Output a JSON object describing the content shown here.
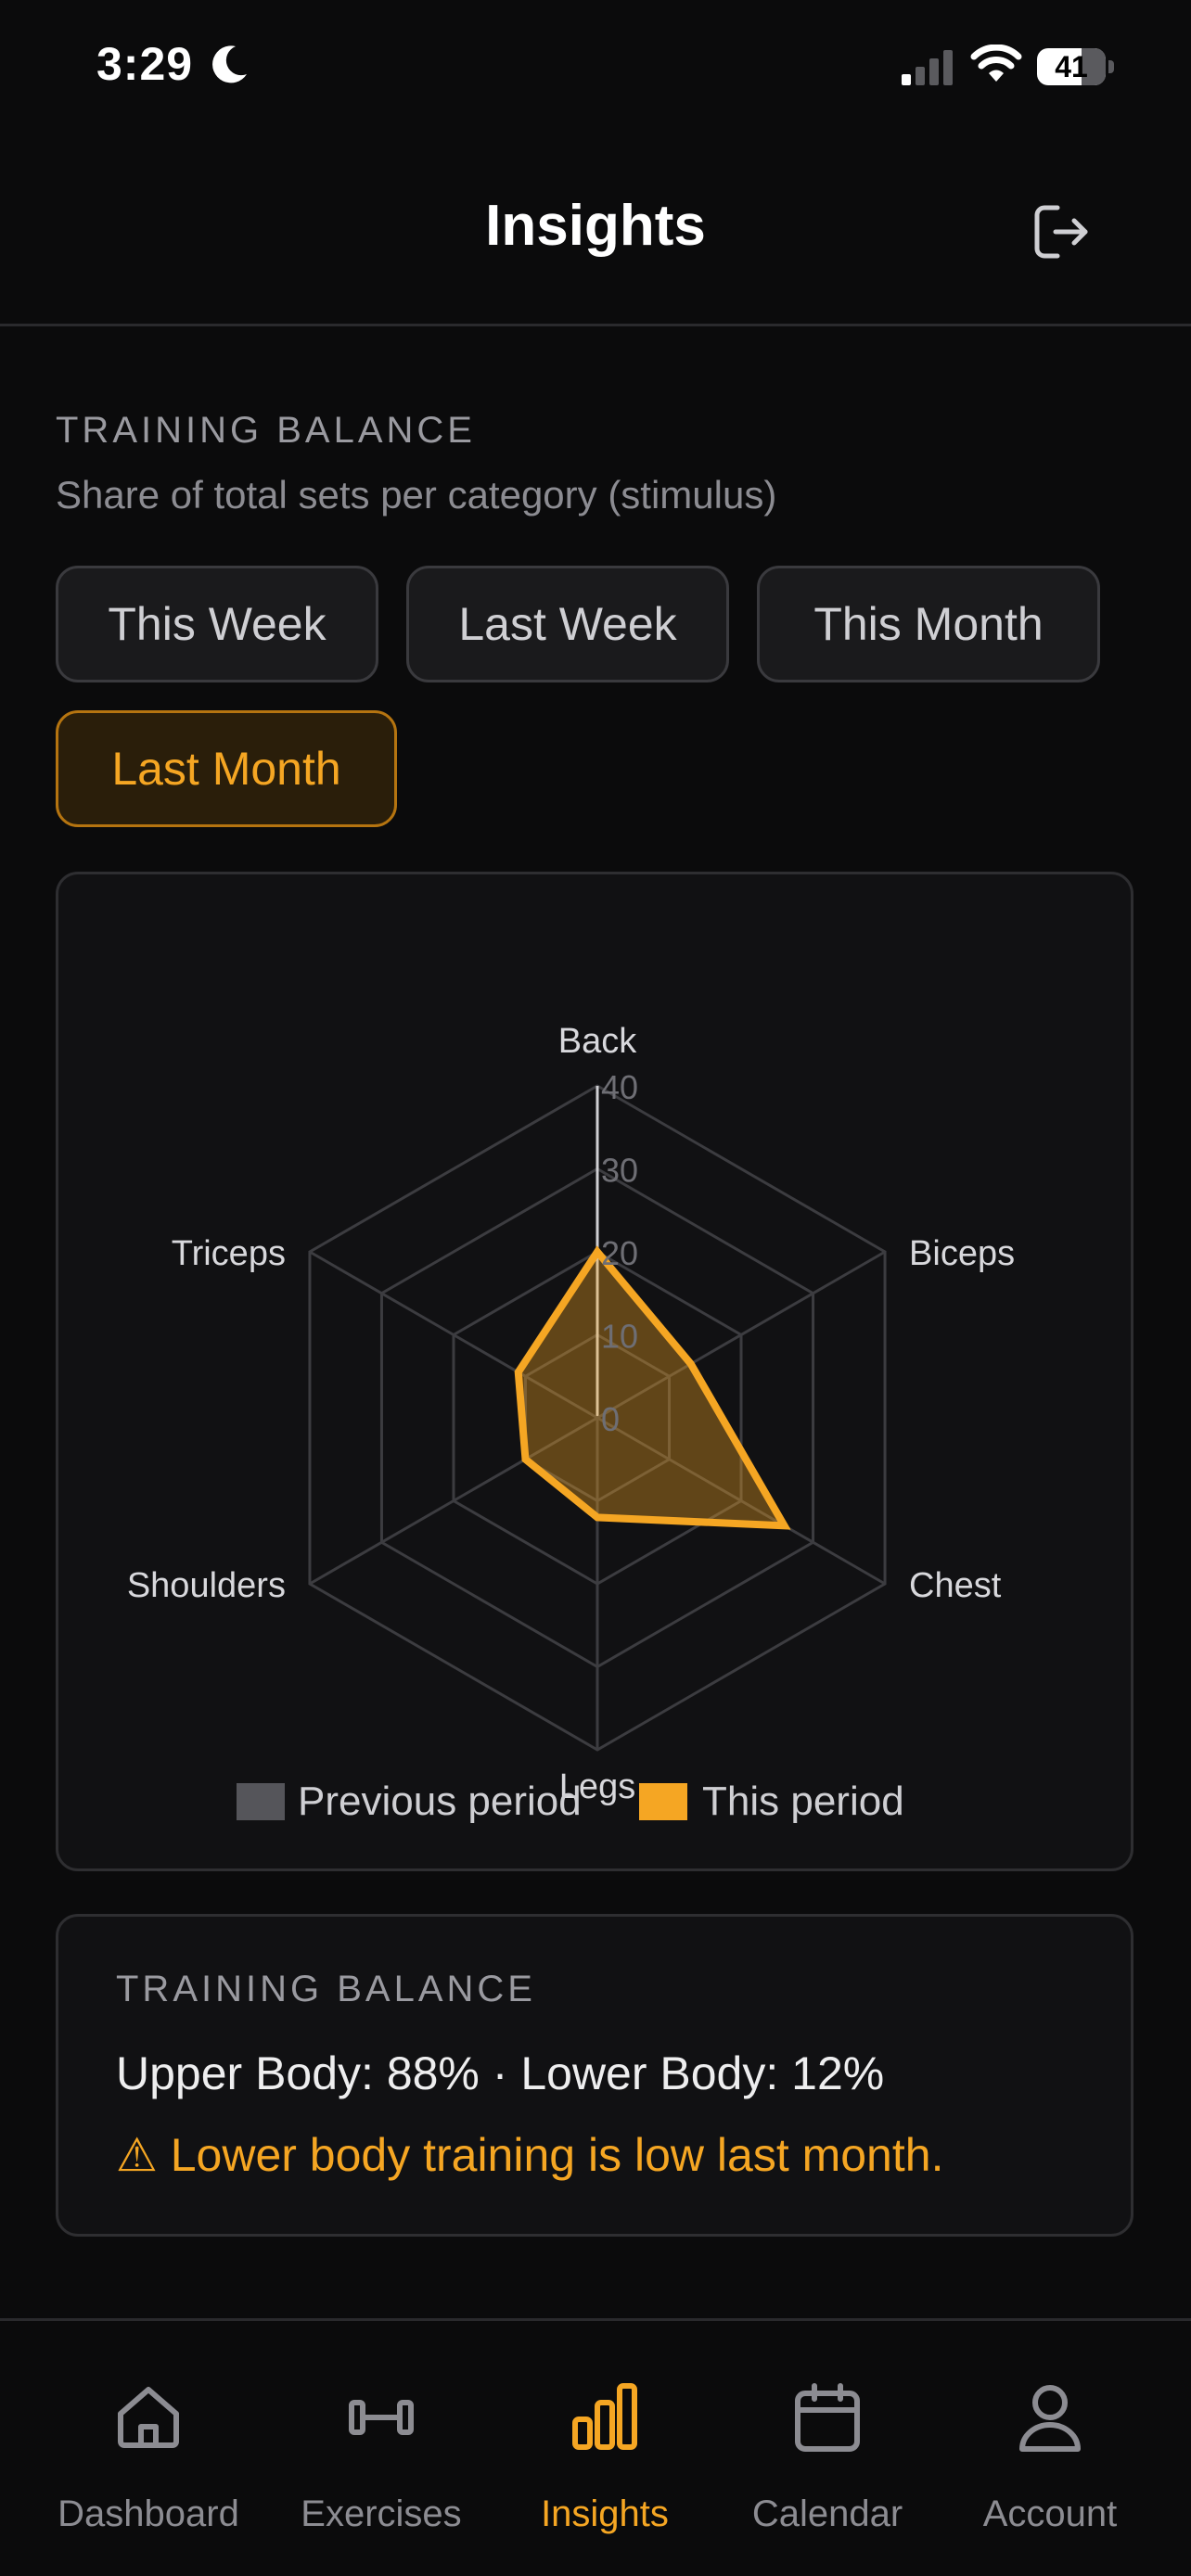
{
  "status": {
    "time": "3:29",
    "battery": "41"
  },
  "header": {
    "title": "Insights"
  },
  "section": {
    "label": "TRAINING BALANCE",
    "subtitle": "Share of total sets per category (stimulus)"
  },
  "periods": [
    {
      "label": "This Week",
      "active": false
    },
    {
      "label": "Last Week",
      "active": false
    },
    {
      "label": "This Month",
      "active": false
    },
    {
      "label": "Last Month",
      "active": true
    }
  ],
  "chart_data": {
    "type": "radar",
    "categories": [
      "Back",
      "Biceps",
      "Chest",
      "Legs",
      "Shoulders",
      "Triceps"
    ],
    "r_ticks": [
      "0",
      "10",
      "20",
      "30",
      "40"
    ],
    "r_range": [
      0,
      40
    ],
    "series": [
      {
        "name": "Previous period",
        "values": [
          0,
          0,
          0,
          0,
          0,
          0
        ],
        "color": "#55555a"
      },
      {
        "name": "This period",
        "values": [
          20,
          13,
          26,
          12,
          10,
          11
        ],
        "color": "#f5a623"
      }
    ],
    "legend_position": "bottom"
  },
  "balance": {
    "label": "TRAINING BALANCE",
    "summary": "Upper Body: 88% · Lower Body: 12%",
    "warning": "⚠ Lower body training is low last month."
  },
  "tabs": [
    {
      "label": "Dashboard",
      "icon": "home-icon",
      "active": false
    },
    {
      "label": "Exercises",
      "icon": "dumbbell-icon",
      "active": false
    },
    {
      "label": "Insights",
      "icon": "bar-chart-icon",
      "active": true
    },
    {
      "label": "Calendar",
      "icon": "calendar-icon",
      "active": false
    },
    {
      "label": "Account",
      "icon": "user-icon",
      "active": false
    }
  ],
  "colors": {
    "accent": "#f5a623",
    "background": "#0b0b0c",
    "card": "#111113"
  }
}
